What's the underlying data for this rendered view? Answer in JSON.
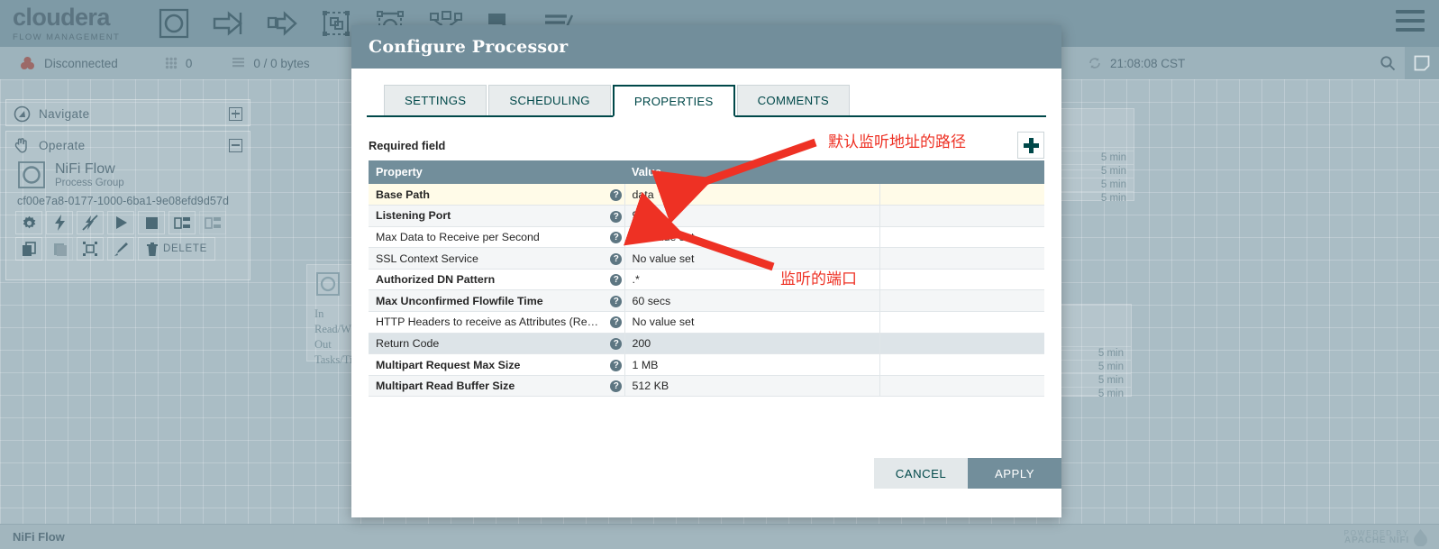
{
  "header": {
    "logo_main": "cloudera",
    "logo_sub": "FLOW MANAGEMENT",
    "toolbar_icons": [
      "processor-icon",
      "input-port-icon",
      "output-port-icon",
      "process-group-icon",
      "remote-process-group-icon",
      "funnel-icon",
      "label-icon",
      "template-icon"
    ],
    "menu_label": "hamburger-menu"
  },
  "statusbar": {
    "connection_status": "Disconnected",
    "thread_count": "0",
    "queue_size": "0 / 0 bytes",
    "clock": "21:08:08 CST",
    "search_icon": "search-icon",
    "notes_icon": "notes-icon"
  },
  "navigate_panel": {
    "title": "Navigate",
    "icon": "navigate-compass-icon",
    "toggle": "expand"
  },
  "operate_panel": {
    "title": "Operate",
    "icon": "operate-hand-icon",
    "toggle": "collapse",
    "component_name": "NiFi Flow",
    "component_type": "Process Group",
    "component_id": "cf00e7a8-0177-1000-6ba1-9e08efd9d57d",
    "actions_row1": [
      {
        "name": "configure",
        "icon": "gear-icon",
        "dim": false
      },
      {
        "name": "enable",
        "icon": "bolt-icon",
        "dim": false
      },
      {
        "name": "disable",
        "icon": "bolt-slash-icon",
        "dim": false
      },
      {
        "name": "start",
        "icon": "play-icon",
        "dim": false
      },
      {
        "name": "stop",
        "icon": "stop-icon",
        "dim": false
      },
      {
        "name": "enable-transmission",
        "icon": "transmit-icon",
        "dim": false
      },
      {
        "name": "disable-transmission",
        "icon": "transmit-off-icon",
        "dim": true
      }
    ],
    "actions_row2": [
      {
        "name": "copy",
        "icon": "copy-icon",
        "dim": false,
        "label": ""
      },
      {
        "name": "paste",
        "icon": "paste-icon",
        "dim": true,
        "label": ""
      },
      {
        "name": "group",
        "icon": "group-icon",
        "dim": false,
        "label": ""
      },
      {
        "name": "color",
        "icon": "paintbrush-icon",
        "dim": false,
        "label": ""
      },
      {
        "name": "delete",
        "icon": "trash-icon",
        "dim": false,
        "label": "DELETE"
      }
    ]
  },
  "canvas": {
    "processor_left": {
      "rows": [
        "In",
        "Read/Wr",
        "Out",
        "Tasks/Ti"
      ]
    },
    "processor_right_1": {
      "rows": [
        "5 min",
        "5 min",
        "5 min",
        "5 min"
      ]
    },
    "processor_right_2": {
      "rows": [
        "5 min",
        "5 min",
        "5 min",
        "5 min"
      ]
    }
  },
  "bottombar": {
    "breadcrumb": "NiFi Flow",
    "powered_line1": "POWERED BY",
    "powered_line2": "APACHE NIFI",
    "powered_icon": "nifi-drop-icon"
  },
  "dialog": {
    "title": "Configure Processor",
    "tabs": [
      {
        "label": "SETTINGS",
        "active": false
      },
      {
        "label": "SCHEDULING",
        "active": false
      },
      {
        "label": "PROPERTIES",
        "active": true
      },
      {
        "label": "COMMENTS",
        "active": false
      }
    ],
    "required_field_label": "Required field",
    "add_property_icon": "plus-icon",
    "columns": [
      "Property",
      "Value"
    ],
    "rows": [
      {
        "name": "Base Path",
        "value": "data",
        "empty": false,
        "required": true,
        "style": "highlight",
        "help": "?"
      },
      {
        "name": "Listening Port",
        "value": "9999",
        "empty": false,
        "required": true,
        "style": "stripe",
        "help": "?"
      },
      {
        "name": "Max Data to Receive per Second",
        "value": "No value set",
        "empty": true,
        "required": false,
        "style": "white",
        "help": "?"
      },
      {
        "name": "SSL Context Service",
        "value": "No value set",
        "empty": true,
        "required": false,
        "style": "stripe",
        "help": "?"
      },
      {
        "name": "Authorized DN Pattern",
        "value": ".*",
        "empty": false,
        "required": true,
        "style": "white",
        "help": "?"
      },
      {
        "name": "Max Unconfirmed Flowfile Time",
        "value": "60 secs",
        "empty": false,
        "required": true,
        "style": "stripe",
        "help": "?"
      },
      {
        "name": "HTTP Headers to receive as Attributes (Reg…",
        "value": "No value set",
        "empty": true,
        "required": false,
        "style": "white",
        "help": "?"
      },
      {
        "name": "Return Code",
        "value": "200",
        "empty": false,
        "required": false,
        "style": "selected",
        "help": "?"
      },
      {
        "name": "Multipart Request Max Size",
        "value": "1 MB",
        "empty": false,
        "required": true,
        "style": "white",
        "help": "?"
      },
      {
        "name": "Multipart Read Buffer Size",
        "value": "512 KB",
        "empty": false,
        "required": true,
        "style": "stripe",
        "help": "?"
      }
    ],
    "cancel_label": "CANCEL",
    "apply_label": "APPLY"
  },
  "annotations": [
    {
      "text": "默认监听地址的路径",
      "target": "Base Path value"
    },
    {
      "text": "监听的端口",
      "target": "Listening Port value"
    }
  ],
  "colors": {
    "header_bg": "#7e9aa6",
    "canvas_bg": "#aabdc5",
    "dialog_header": "#728e9b",
    "table_header": "#728e9b",
    "accent_dark": "#004849",
    "annotation_red": "#ee3124",
    "required_row": "#fffbe8",
    "selected_row": "#dde4e8",
    "apply_button": "#728e9b"
  }
}
